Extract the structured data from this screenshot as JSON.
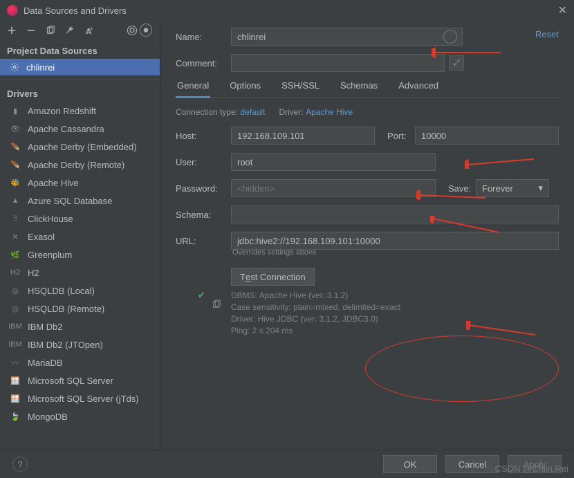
{
  "title": "Data Sources and Drivers",
  "reset_label": "Reset",
  "sidebar": {
    "section_project": "Project Data Sources",
    "datasource": "chlinrei",
    "section_drivers": "Drivers",
    "drivers": [
      "Amazon Redshift",
      "Apache Cassandra",
      "Apache Derby (Embedded)",
      "Apache Derby (Remote)",
      "Apache Hive",
      "Azure SQL Database",
      "ClickHouse",
      "Exasol",
      "Greenplum",
      "H2",
      "HSQLDB (Local)",
      "HSQLDB (Remote)",
      "IBM Db2",
      "IBM Db2 (JTOpen)",
      "MariaDB",
      "Microsoft SQL Server",
      "Microsoft SQL Server (jTds)",
      "MongoDB"
    ]
  },
  "form": {
    "name_lbl": "Name:",
    "name": "chlinrei",
    "comment_lbl": "Comment:",
    "tabs": [
      "General",
      "Options",
      "SSH/SSL",
      "Schemas",
      "Advanced"
    ],
    "conn_type_lbl": "Connection type:",
    "conn_type": "default",
    "driver_lbl": "Driver:",
    "driver": "Apache Hive",
    "host_lbl": "Host:",
    "host": "192.168.109.101",
    "port_lbl": "Port:",
    "port": "10000",
    "user_lbl": "User:",
    "user": "root",
    "pass_lbl": "Password:",
    "pass_ph": "<hidden>",
    "save_lbl": "Save:",
    "save_val": "Forever",
    "schema_lbl": "Schema:",
    "url_lbl": "URL:",
    "url": "jdbc:hive2://192.168.109.101:10000",
    "url_note": "Overrides settings above",
    "test_label_pre": "T",
    "test_label_u": "e",
    "test_label_post": "st Connection",
    "result": {
      "l1": "DBMS: Apache Hive (ver. 3.1.2)",
      "l2": "Case sensitivity: plain=mixed, delimited=exact",
      "l3": "Driver: Hive JDBC (ver. 3.1.2, JDBC3.0)",
      "l4": "Ping: 2 s 204 ms"
    }
  },
  "footer": {
    "ok": "OK",
    "cancel": "Cancel",
    "apply": "Apply"
  },
  "watermark": "CSDN @Chlin.Rei"
}
